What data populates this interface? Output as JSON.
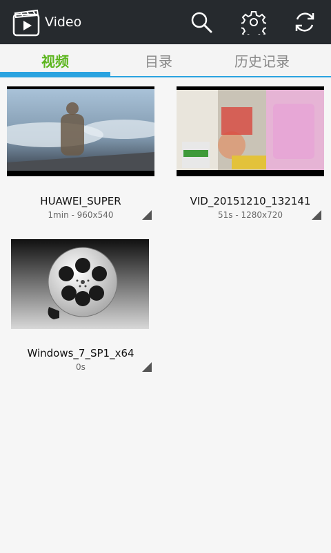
{
  "header": {
    "title": "Video",
    "icons": [
      "video-app-icon",
      "search-icon",
      "settings-gear-icon",
      "refresh-icon"
    ]
  },
  "tabs": [
    {
      "label": "视频",
      "active": true
    },
    {
      "label": "目录",
      "active": false
    },
    {
      "label": "历史记录",
      "active": false
    }
  ],
  "videos": [
    {
      "name": "HUAWEI_SUPER",
      "meta": "1min - 960x540"
    },
    {
      "name": "VID_20151210_132141",
      "meta": "51s - 1280x720"
    },
    {
      "name": "Windows_7_SP1_x64",
      "meta": "0s"
    }
  ],
  "colors": {
    "topbar": "#262a2e",
    "accent": "#2aa3e0",
    "active_tab": "#5bb51c",
    "background": "#f6f6f6"
  }
}
